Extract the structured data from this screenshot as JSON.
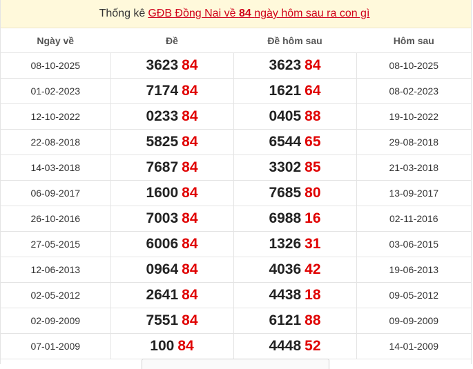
{
  "title": {
    "prefix": "Thống kê",
    "link_before": "GĐB Đồng Nai về",
    "link_number": "84",
    "link_after": "ngày hôm sau ra con gì"
  },
  "table": {
    "headers": [
      "Ngày về",
      "Đề",
      "Đề hôm sau",
      "Hôm sau"
    ],
    "rows": [
      {
        "date": "08-10-2025",
        "de_head": "3623",
        "de_tail": "84",
        "next_head": "3623",
        "next_tail": "84",
        "next_date": "08-10-2025"
      },
      {
        "date": "01-02-2023",
        "de_head": "7174",
        "de_tail": "84",
        "next_head": "1621",
        "next_tail": "64",
        "next_date": "08-02-2023"
      },
      {
        "date": "12-10-2022",
        "de_head": "0233",
        "de_tail": "84",
        "next_head": "0405",
        "next_tail": "88",
        "next_date": "19-10-2022"
      },
      {
        "date": "22-08-2018",
        "de_head": "5825",
        "de_tail": "84",
        "next_head": "6544",
        "next_tail": "65",
        "next_date": "29-08-2018"
      },
      {
        "date": "14-03-2018",
        "de_head": "7687",
        "de_tail": "84",
        "next_head": "3302",
        "next_tail": "85",
        "next_date": "21-03-2018"
      },
      {
        "date": "06-09-2017",
        "de_head": "1600",
        "de_tail": "84",
        "next_head": "7685",
        "next_tail": "80",
        "next_date": "13-09-2017"
      },
      {
        "date": "26-10-2016",
        "de_head": "7003",
        "de_tail": "84",
        "next_head": "6988",
        "next_tail": "16",
        "next_date": "02-11-2016"
      },
      {
        "date": "27-05-2015",
        "de_head": "6006",
        "de_tail": "84",
        "next_head": "1326",
        "next_tail": "31",
        "next_date": "03-06-2015"
      },
      {
        "date": "12-06-2013",
        "de_head": "0964",
        "de_tail": "84",
        "next_head": "4036",
        "next_tail": "42",
        "next_date": "19-06-2013"
      },
      {
        "date": "02-05-2012",
        "de_head": "2641",
        "de_tail": "84",
        "next_head": "4438",
        "next_tail": "18",
        "next_date": "09-05-2012"
      },
      {
        "date": "02-09-2009",
        "de_head": "7551",
        "de_tail": "84",
        "next_head": "6121",
        "next_tail": "88",
        "next_date": "09-09-2009"
      },
      {
        "date": "07-01-2009",
        "de_head": "100",
        "de_tail": "84",
        "next_head": "4448",
        "next_tail": "52",
        "next_date": "14-01-2009"
      }
    ]
  },
  "colors": {
    "title_bg": "#fff9db",
    "highlight_red": "#e00000",
    "link_red": "#d0021b"
  }
}
